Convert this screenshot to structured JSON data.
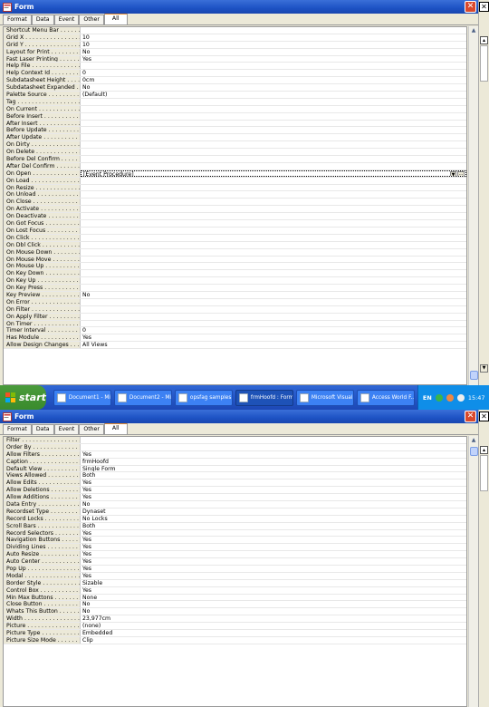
{
  "window1": {
    "title": "Form",
    "tabs": [
      "Format",
      "Data",
      "Event",
      "Other",
      "All"
    ],
    "active_tab": "All",
    "rows": [
      {
        "label": "Shortcut Menu Bar . . . . . . . .",
        "value": ""
      },
      {
        "label": "Grid X . . . . . . . . . . . . . . . .",
        "value": "10"
      },
      {
        "label": "Grid Y . . . . . . . . . . . . . . . .",
        "value": "10"
      },
      {
        "label": "Layout for Print . . . . . . . . .",
        "value": "No"
      },
      {
        "label": "Fast Laser Printing . . . . . . .",
        "value": "Yes"
      },
      {
        "label": "Help File . . . . . . . . . . . . . .",
        "value": ""
      },
      {
        "label": "Help Context Id . . . . . . . . .",
        "value": "0"
      },
      {
        "label": "Subdatasheet Height . . . . . .",
        "value": "0cm"
      },
      {
        "label": "Subdatasheet Expanded . . .",
        "value": "No"
      },
      {
        "label": "Palette Source . . . . . . . . . .",
        "value": "(Default)"
      },
      {
        "label": "Tag . . . . . . . . . . . . . . . . . .",
        "value": ""
      },
      {
        "label": "On Current . . . . . . . . . . . .",
        "value": ""
      },
      {
        "label": "Before Insert . . . . . . . . . . .",
        "value": ""
      },
      {
        "label": "After Insert . . . . . . . . . . . .",
        "value": ""
      },
      {
        "label": "Before Update . . . . . . . . . .",
        "value": ""
      },
      {
        "label": "After Update . . . . . . . . . . .",
        "value": ""
      },
      {
        "label": "On Dirty . . . . . . . . . . . . . .",
        "value": ""
      },
      {
        "label": "On Delete . . . . . . . . . . . . .",
        "value": ""
      },
      {
        "label": "Before Del Confirm . . . . . . .",
        "value": ""
      },
      {
        "label": "After Del Confirm . . . . . . . .",
        "value": ""
      },
      {
        "label": "On Open . . . . . . . . . . . . . .",
        "value": "[Event Procedure]",
        "selected": true
      },
      {
        "label": "On Load . . . . . . . . . . . . . .",
        "value": ""
      },
      {
        "label": "On Resize . . . . . . . . . . . . .",
        "value": ""
      },
      {
        "label": "On Unload . . . . . . . . . . . . .",
        "value": ""
      },
      {
        "label": "On Close . . . . . . . . . . . . .",
        "value": ""
      },
      {
        "label": "On Activate . . . . . . . . . . . .",
        "value": ""
      },
      {
        "label": "On Deactivate . . . . . . . . . .",
        "value": ""
      },
      {
        "label": "On Got Focus . . . . . . . . . .",
        "value": ""
      },
      {
        "label": "On Lost Focus . . . . . . . . . .",
        "value": ""
      },
      {
        "label": "On Click . . . . . . . . . . . . . .",
        "value": ""
      },
      {
        "label": "On Dbl Click . . . . . . . . . . .",
        "value": ""
      },
      {
        "label": "On Mouse Down . . . . . . . .",
        "value": ""
      },
      {
        "label": "On Mouse Move . . . . . . . .",
        "value": ""
      },
      {
        "label": "On Mouse Up . . . . . . . . . .",
        "value": ""
      },
      {
        "label": "On Key Down . . . . . . . . . .",
        "value": ""
      },
      {
        "label": "On Key Up . . . . . . . . . . . .",
        "value": ""
      },
      {
        "label": "On Key Press . . . . . . . . . .",
        "value": ""
      },
      {
        "label": "Key Preview . . . . . . . . . . .",
        "value": "No"
      },
      {
        "label": "On Error . . . . . . . . . . . . . .",
        "value": ""
      },
      {
        "label": "On Filter . . . . . . . . . . . . . .",
        "value": ""
      },
      {
        "label": "On Apply Filter . . . . . . . . . .",
        "value": ""
      },
      {
        "label": "On Timer . . . . . . . . . . . . . .",
        "value": ""
      },
      {
        "label": "Timer Interval . . . . . . . . . . .",
        "value": "0"
      },
      {
        "label": "Has Module . . . . . . . . . . . .",
        "value": "Yes"
      },
      {
        "label": "Allow Design Changes . . . . .",
        "value": "All Views"
      }
    ]
  },
  "taskbar": {
    "start_label": "start",
    "tasks": [
      {
        "label": "Document1 - Mi...",
        "active": false
      },
      {
        "label": "Document2 - Mi...",
        "active": false
      },
      {
        "label": "opsfag samples...",
        "active": false
      },
      {
        "label": "frmHoofd : Form",
        "active": true
      },
      {
        "label": "Microsoft Visual...",
        "active": false
      },
      {
        "label": "Access World F...",
        "active": false
      }
    ],
    "lang": "EN",
    "clock": "15:47"
  },
  "window2": {
    "title": "Form",
    "tabs": [
      "Format",
      "Data",
      "Event",
      "Other",
      "All"
    ],
    "active_tab": "All",
    "rows": [
      {
        "label": "Filter . . . . . . . . . . . . . . . . .",
        "value": ""
      },
      {
        "label": "Order By . . . . . . . . . . . . . .",
        "value": ""
      },
      {
        "label": "Allow Filters . . . . . . . . . . .",
        "value": "Yes"
      },
      {
        "label": "Caption . . . . . . . . . . . . . . .",
        "value": "frmHoofd"
      },
      {
        "label": "Default View . . . . . . . . . . .",
        "value": "Single Form"
      },
      {
        "label": "Views Allowed . . . . . . . . . .",
        "value": "Both"
      },
      {
        "label": "Allow Edits . . . . . . . . . . . .",
        "value": "Yes"
      },
      {
        "label": "Allow Deletions . . . . . . . . .",
        "value": "Yes"
      },
      {
        "label": "Allow Additions . . . . . . . . .",
        "value": "Yes"
      },
      {
        "label": "Data Entry . . . . . . . . . . . . .",
        "value": "No"
      },
      {
        "label": "Recordset Type . . . . . . . . .",
        "value": "Dynaset"
      },
      {
        "label": "Record Locks . . . . . . . . . . .",
        "value": "No Locks"
      },
      {
        "label": "Scroll Bars . . . . . . . . . . . .",
        "value": "Both"
      },
      {
        "label": "Record Selectors . . . . . . . .",
        "value": "Yes"
      },
      {
        "label": "Navigation Buttons . . . . . . .",
        "value": "Yes"
      },
      {
        "label": "Dividing Lines . . . . . . . . . .",
        "value": "Yes"
      },
      {
        "label": "Auto Resize . . . . . . . . . . . .",
        "value": "Yes"
      },
      {
        "label": "Auto Center . . . . . . . . . . . .",
        "value": "Yes"
      },
      {
        "label": "Pop Up . . . . . . . . . . . . . . .",
        "value": "Yes"
      },
      {
        "label": "Modal . . . . . . . . . . . . . . . .",
        "value": "Yes"
      },
      {
        "label": "Border Style . . . . . . . . . . .",
        "value": "Sizable"
      },
      {
        "label": "Control Box . . . . . . . . . . . .",
        "value": "Yes"
      },
      {
        "label": "Min Max Buttons . . . . . . . .",
        "value": "None"
      },
      {
        "label": "Close Button . . . . . . . . . . .",
        "value": "No"
      },
      {
        "label": "Whats This Button . . . . . . .",
        "value": "No"
      },
      {
        "label": "Width . . . . . . . . . . . . . . . .",
        "value": "23,977cm"
      },
      {
        "label": "Picture . . . . . . . . . . . . . . .",
        "value": "(none)"
      },
      {
        "label": "Picture Type . . . . . . . . . . .",
        "value": "Embedded"
      },
      {
        "label": "Picture Size Mode . . . . . . .",
        "value": "Clip"
      }
    ]
  },
  "icons": {
    "window_icon": "form-icon",
    "close": "close-icon",
    "scroll_up": "scroll-up-icon",
    "scroll_down": "scroll-down-icon",
    "dropdown": "dropdown-arrow-icon",
    "builder": "builder-ellipsis-icon"
  },
  "colors": {
    "titlebar": "#1d52c4",
    "taskbar": "#2456c7",
    "start": "#3a8b2c",
    "active_tab_accent": "#e68b2c"
  }
}
